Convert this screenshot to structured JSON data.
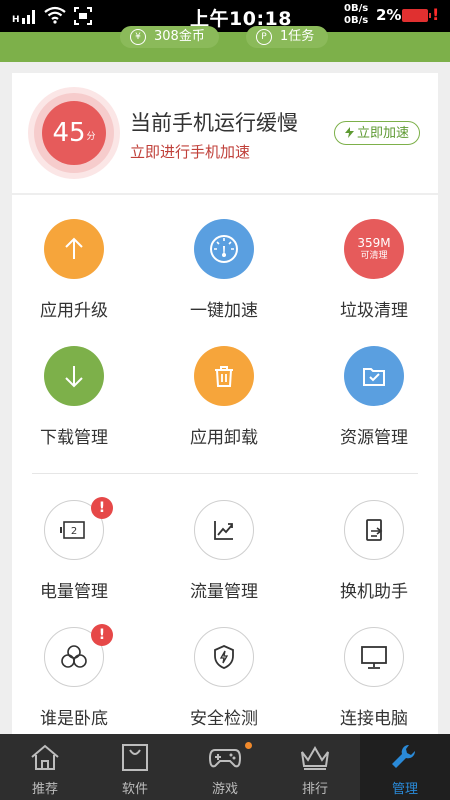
{
  "status_bar": {
    "network_label": "H",
    "time": "上午10:18",
    "speed_up": "0B/s",
    "speed_down": "0B/s",
    "battery_percent": "2%",
    "battery_alert": "!"
  },
  "header": {
    "coins_icon": "¥",
    "coins": "308金币",
    "tasks_icon": "P",
    "tasks": "1任务"
  },
  "speed_card": {
    "score": "45",
    "score_unit": "分",
    "title": "当前手机运行缓慢",
    "subtitle": "立即进行手机加速",
    "boost_button": "立即加速",
    "colors": {
      "score": "#e65b5b",
      "accent": "#7db04a"
    }
  },
  "tools": [
    {
      "label": "应用升级",
      "icon": "arrow-up-icon",
      "color": "#f6a53b"
    },
    {
      "label": "一键加速",
      "icon": "speedometer-icon",
      "color": "#5a9fe0"
    },
    {
      "label": "垃圾清理",
      "icon": "junk-size-icon",
      "color": "#e65b5b",
      "size_text": "359M",
      "sub_text": "可清理"
    },
    {
      "label": "下载管理",
      "icon": "arrow-down-icon",
      "color": "#7db04a"
    },
    {
      "label": "应用卸载",
      "icon": "trash-icon",
      "color": "#f6a53b"
    },
    {
      "label": "资源管理",
      "icon": "folder-check-icon",
      "color": "#5a9fe0"
    },
    {
      "label": "电量管理",
      "icon": "battery-icon",
      "battery_text": "2",
      "badge": "!"
    },
    {
      "label": "流量管理",
      "icon": "chart-trend-icon"
    },
    {
      "label": "换机助手",
      "icon": "phone-transfer-icon"
    },
    {
      "label": "谁是卧底",
      "icon": "group-icon",
      "badge": "!"
    },
    {
      "label": "安全检测",
      "icon": "shield-bolt-icon"
    },
    {
      "label": "连接电脑",
      "icon": "monitor-icon"
    }
  ],
  "bottom_nav": [
    {
      "label": "推荐",
      "icon": "home-icon"
    },
    {
      "label": "软件",
      "icon": "bag-icon"
    },
    {
      "label": "游戏",
      "icon": "gamepad-icon",
      "has_dot": true
    },
    {
      "label": "排行",
      "icon": "crown-icon"
    },
    {
      "label": "管理",
      "icon": "wrench-icon",
      "active": true
    }
  ]
}
